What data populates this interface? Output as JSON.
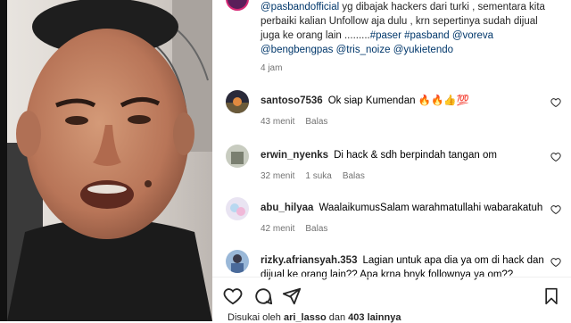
{
  "caption": {
    "line1_prefix": "@pasbandofficial",
    "line1_text": " yg dibajak hackers dari turki , sementara kita",
    "line2": "perbaiki kalian Unfollow aja dulu , krn sepertinya sudah dijual",
    "line3_text": "juga ke orang lain .........",
    "tag_paser": "#paser",
    "tag_pasband": "#pasband",
    "tag_voreva": "@voreva",
    "tag_bengbengpas": "@bengbengpas",
    "tag_tris": "@tris_noize",
    "tag_yukie": "@yukietendo",
    "time": "4 jam"
  },
  "comments": [
    {
      "user": "santoso7536",
      "text": "Ok siap Kumendan 🔥🔥👍💯",
      "time": "43 menit",
      "likes": "",
      "reply": "Balas"
    },
    {
      "user": "erwin_nyenks",
      "text": "Di hack & sdh berpindah tangan om",
      "time": "32 menit",
      "likes": "1 suka",
      "reply": "Balas"
    },
    {
      "user": "abu_hilyaa",
      "text": "WaalaikumusSalam warahmatullahi wabarakatuh",
      "time": "42 menit",
      "likes": "",
      "reply": "Balas"
    },
    {
      "user": "rizky.afriansyah.353",
      "text": "Lagian untuk apa dia ya om di hack dan dijual ke orang lain?? Apa krna bnyk follownya ya om??",
      "time": "",
      "likes": "",
      "reply": ""
    }
  ],
  "liked_by": {
    "prefix": "Disukai oleh ",
    "user": "ari_lasso",
    "middle": " dan ",
    "count": "403 lainnya"
  },
  "icons": [
    "heart-icon",
    "comment-icon",
    "share-icon",
    "bookmark-icon"
  ],
  "colors": {
    "link": "#00376b",
    "text": "#262626",
    "muted": "#737373"
  }
}
